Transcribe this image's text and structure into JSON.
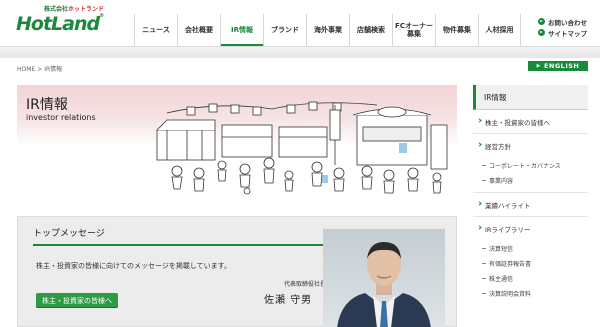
{
  "brand": {
    "small_text_green": "株式会社",
    "small_text_red": "ホットランド",
    "logo_text": "HotLand",
    "logo_mark": "®"
  },
  "gnav": {
    "items": [
      {
        "label": "ニュース",
        "active": false
      },
      {
        "label": "会社概要",
        "active": false
      },
      {
        "label": "IR情報",
        "active": true
      },
      {
        "label": "ブランド",
        "active": false
      },
      {
        "label": "海外事業",
        "active": false
      },
      {
        "label": "店舗検索",
        "active": false
      },
      {
        "label_line1": "FCオーナー",
        "label_line2": "募集",
        "active": false
      },
      {
        "label": "物件募集",
        "active": false
      },
      {
        "label": "人材採用",
        "active": false
      }
    ]
  },
  "util": {
    "contact": "お問い合わせ",
    "sitemap": "サイトマップ"
  },
  "breadcrumb": {
    "home": "HOME",
    "sep": ">",
    "current": "IR情報"
  },
  "english_button": "ENGLISH",
  "hero": {
    "title": "IR情報",
    "subtitle": "investor relations"
  },
  "message": {
    "title": "トップメッセージ",
    "body": "株主・投資家の皆様に向けてのメッセージを掲載しています。",
    "role": "代表取締役社長",
    "name": "佐瀬 守男",
    "button": "株主・投資家の皆様へ"
  },
  "sidebar": {
    "head": "IR情報",
    "items": [
      {
        "label": "株主・投資家の皆様へ"
      },
      {
        "label": "経営方針",
        "subs": [
          "コーポレート・ガバナンス",
          "事業内容"
        ]
      },
      {
        "label": "業績ハイライト"
      },
      {
        "label": "IRライブラリー",
        "subs": [
          "決算短信",
          "有価証券報告書",
          "株主通信",
          "決算説明会資料"
        ]
      }
    ]
  },
  "colors": {
    "brand_green": "#1a8a3a",
    "brand_red": "#d62b2b",
    "hero_pink": "#f1d4d6"
  }
}
